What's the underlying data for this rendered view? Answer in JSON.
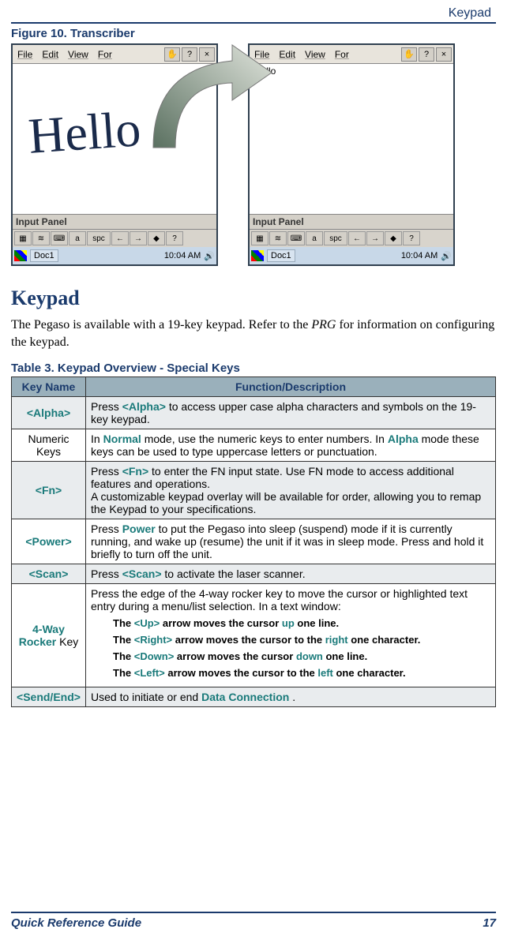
{
  "header": {
    "section": "Keypad"
  },
  "figure": {
    "caption": "Figure 10. Transcriber",
    "menus": {
      "file": "File",
      "edit": "Edit",
      "view": "View",
      "for": "For"
    },
    "menu_icons": {
      "hand": "✋",
      "help": "?",
      "close": "×"
    },
    "canvas": {
      "handwritten": "Hello",
      "typed": "Hello"
    },
    "input_panel": "Input Panel",
    "toolbar": {
      "b1": "▦",
      "b2": "≋",
      "b3": "⌨",
      "b4": "a",
      "spc": "spc",
      "left": "←",
      "right": "→",
      "bullet": "◆",
      "qm": "?"
    },
    "taskbar": {
      "doc": "Doc1",
      "time": "10:04 AM"
    }
  },
  "section": {
    "title": "Keypad",
    "intro_a": "The Pegaso is available with a 19-key keypad. Refer to the ",
    "intro_prg": "PRG",
    "intro_b": " for information on configuring the keypad."
  },
  "table": {
    "caption": "Table 3. Keypad Overview - Special Keys",
    "headers": {
      "col1": "Key Name",
      "col2": "Function/Description"
    },
    "rows": {
      "alpha": {
        "name": "<Alpha>",
        "desc_a": "Press ",
        "desc_key": "<Alpha>",
        "desc_b": " to access upper case alpha characters and symbols on the 19-key keypad."
      },
      "numeric": {
        "name": "Numeric Keys",
        "desc_a": "In ",
        "normal": "Normal",
        "desc_b": " mode, use the numeric keys to enter numbers. In ",
        "alpha": "Alpha",
        "desc_c": " mode these keys can be used to type uppercase letters or punctuation."
      },
      "fn": {
        "name": "<Fn>",
        "desc_a": "Press ",
        "desc_key": "<Fn>",
        "desc_b": " to enter the FN input state. Use FN mode to access additional features and operations.",
        "desc_c": "A customizable keypad overlay will be available for order, allowing you to remap the Keypad to your specifications."
      },
      "power": {
        "name": "<Power>",
        "desc_a": "Press ",
        "desc_key": "Power",
        "desc_b": " to put the Pegaso into sleep (suspend) mode if it is currently running, and wake up (resume) the unit if it was in sleep mode. Press and hold it briefly to turn off the unit."
      },
      "scan": {
        "name": "<Scan>",
        "desc_a": "Press ",
        "desc_key": "<Scan>",
        "desc_b": " to activate the laser scanner."
      },
      "rocker": {
        "name_a": "4-Way Rocker",
        "name_b": " Key",
        "desc_intro": "Press the edge of the 4-way rocker key to move the cursor or highlighted text entry during a menu/list selection. In a text window:",
        "up_a": "The ",
        "up_key": "<Up>",
        "up_b": " arrow moves the cursor ",
        "up_dir": "up",
        "up_c": " one line.",
        "rt_a": "The ",
        "rt_key": "<Right>",
        "rt_b": " arrow moves the cursor to the ",
        "rt_dir": "right",
        "rt_c": " one character.",
        "dn_a": "The ",
        "dn_key": "<Down>",
        "dn_b": " arrow moves the cursor ",
        "dn_dir": "down",
        "dn_c": " one line.",
        "lf_a": "The ",
        "lf_key": "<Left>",
        "lf_b": " arrow moves the cursor to the ",
        "lf_dir": "left",
        "lf_c": " one character."
      },
      "sendend": {
        "name": "<Send/End>",
        "desc_a": "Used to initiate or end ",
        "desc_key": "Data Connection",
        "desc_b": "  ."
      }
    }
  },
  "footer": {
    "guide": "Quick Reference Guide",
    "page": "17"
  }
}
